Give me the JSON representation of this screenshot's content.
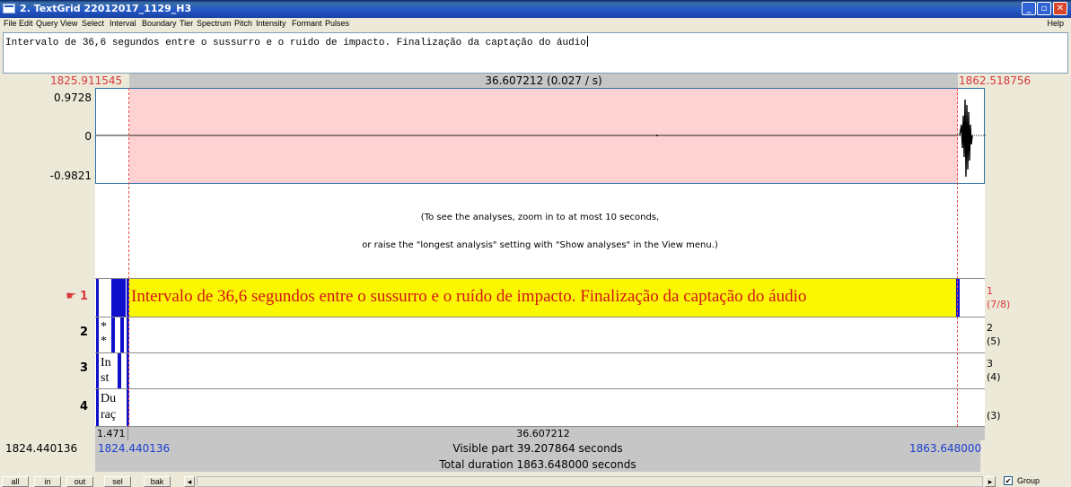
{
  "window": {
    "title": "2. TextGrid 22012017_1129_H3",
    "min_icon": "minimize-icon",
    "max_icon": "maximize-icon",
    "close_icon": "close-icon"
  },
  "menu": {
    "items": [
      "File",
      "Edit",
      "Query",
      "View",
      "Select",
      "Interval",
      "Boundary",
      "Tier",
      "Spectrum",
      "Pitch",
      "Intensity",
      "Formant",
      "Pulses"
    ],
    "help": "Help"
  },
  "textfield": {
    "value": "Intervalo de 36,6 segundos entre o sussurro e o ruido de impacto. Finalização da captação do áudio"
  },
  "selection": {
    "start": "1825.911545",
    "end": "1862.518756",
    "duration": "36.607212 (0.027 / s)"
  },
  "waveform": {
    "amp_max": "0.9728",
    "amp_zero": "0",
    "amp_min": "-0.9821",
    "selection_color": "#fed2d2"
  },
  "analyses": {
    "line1": "(To see the analyses, zoom in to at most 10 seconds,",
    "line2": "or raise the \"longest analysis\" setting with \"Show analyses\" in the View menu.)"
  },
  "tiers": [
    {
      "number": "1",
      "pointer_icon": "hand-pointer-icon",
      "text": "Intervalo de 36,6 segundos entre o sussurro e o ruído de impacto. Finalização da captação do áudio",
      "right_label": "1",
      "right_count": "(7/8)"
    },
    {
      "number": "2",
      "small_text": [
        "*",
        "*"
      ],
      "right_label": "2",
      "right_count": "(5)"
    },
    {
      "number": "3",
      "small_text": [
        "In",
        "st"
      ],
      "right_label": "3",
      "right_count": "(4)"
    },
    {
      "number": "4",
      "small_text": [
        "Du",
        "raç"
      ],
      "right_label": "",
      "right_count": "(3)"
    }
  ],
  "bottom": {
    "left_piece": "1.471",
    "sel_duration": "36.607212",
    "window_start": "1824.440136",
    "visible_start": "1824.440136",
    "visible_part": "Visible part 39.207864 seconds",
    "visible_end": "1863.648000",
    "total_duration": "Total duration 1863.648000 seconds"
  },
  "buttons": {
    "all": "all",
    "in": "in",
    "out": "out",
    "sel": "sel",
    "bak": "bak",
    "scroll_left_icon": "arrow-left-icon",
    "scroll_right_icon": "arrow-right-icon",
    "group_label": "Group",
    "group_checked": true
  },
  "colors": {
    "title_bar": "#2458C8",
    "selection_red": "#d9373b",
    "interval_yellow": "#fbf700",
    "blue_marks": "#1a3fd0"
  }
}
